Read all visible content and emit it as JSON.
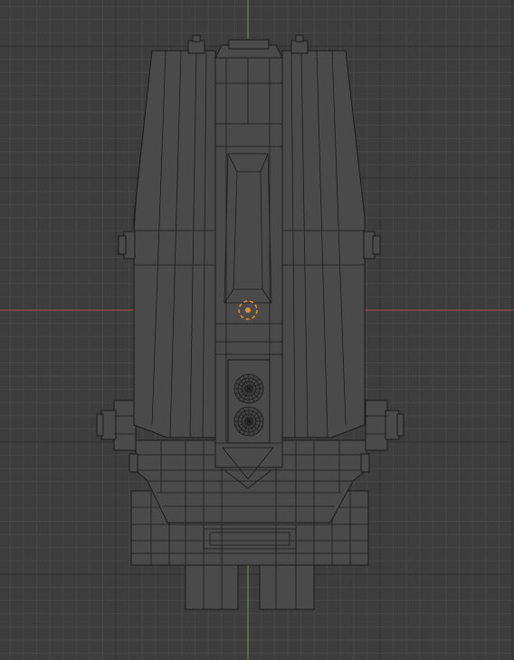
{
  "viewport": {
    "view": "top-orthographic",
    "shading": "solid",
    "overlay": "wireframe",
    "colors": {
      "background": "#3d3d3d",
      "grid_minor": "#474747",
      "grid_major": "#2f2f2f",
      "x_axis": "#b24b55",
      "y_axis": "#6f9a3b",
      "object_fill": "#4a4a4a",
      "object_fill_dark": "#424242",
      "object_fill_light": "#535353",
      "wire": "#1b1b1b",
      "origin_marker": "#e88a30"
    }
  },
  "scene": {
    "object_icons": {
      "mesh": "robot-mesh-icon",
      "origin": "object-origin-icon"
    }
  }
}
